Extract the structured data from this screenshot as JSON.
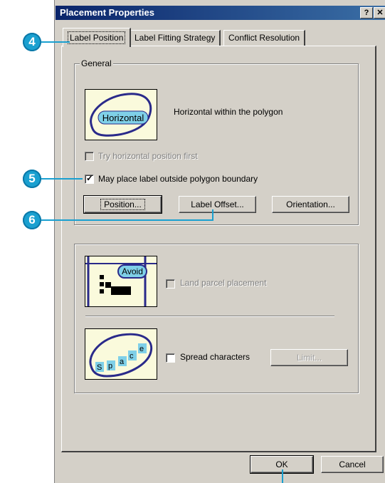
{
  "window": {
    "title": "Placement Properties",
    "help_btn": "?",
    "close_btn": "✕"
  },
  "tabs": [
    {
      "label": "Label Position",
      "active": true
    },
    {
      "label": "Label Fitting Strategy",
      "active": false
    },
    {
      "label": "Conflict Resolution",
      "active": false
    }
  ],
  "general": {
    "legend": "General",
    "preview_text": "Horizontal",
    "description": "Horizontal within the polygon",
    "try_horizontal": {
      "label": "Try horizontal position first",
      "checked": false,
      "enabled": false
    },
    "place_outside": {
      "label": "May place label outside polygon boundary",
      "checked": true,
      "enabled": true
    },
    "buttons": {
      "position": "Position...",
      "label_offset": "Label Offset...",
      "orientation": "Orientation..."
    }
  },
  "fitting": {
    "avoid_text": "Avoid",
    "land_parcel": {
      "label": "Land parcel placement",
      "checked": false,
      "enabled": false
    },
    "space_text": "space",
    "spread": {
      "label": "Spread characters",
      "checked": false,
      "enabled": true
    },
    "limit_button": "Limit..."
  },
  "footer": {
    "ok": "OK",
    "cancel": "Cancel"
  },
  "callouts": [
    "4",
    "5",
    "6"
  ],
  "colors": {
    "titlebar": "#0a246a",
    "callout": "#1aa0d0",
    "preview_fill": "#fafadc",
    "polygon_outline": "#2a2a8a",
    "label_fill": "#7fd0e8"
  }
}
